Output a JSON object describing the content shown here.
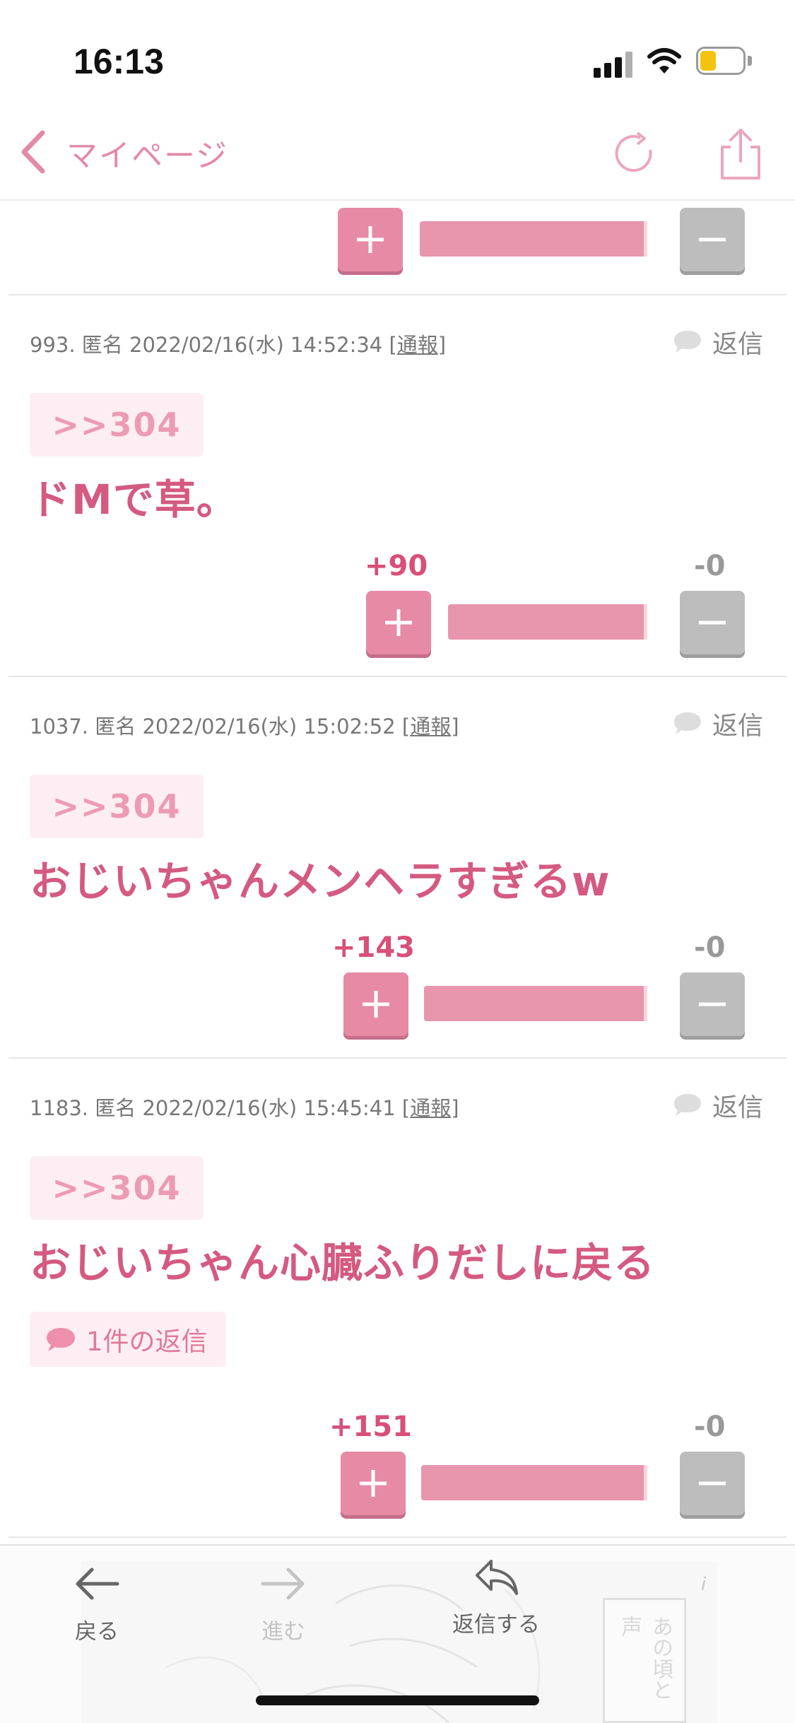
{
  "status_bar": {
    "time": "16:13"
  },
  "nav": {
    "title": "マイページ"
  },
  "colors": {
    "accent": "#e68aa6",
    "accent_dark": "#d45a80",
    "minus": "#bdbdbd"
  },
  "posts": [
    {
      "meta_prefix": "993. 匿名 2022/02/16(水) 14:52:34 [",
      "report": "通報",
      "meta_suffix": "]",
      "reply": "返信",
      "anchor": ">>304",
      "text": "ドMで草。",
      "plus": "+90",
      "minus": "-0",
      "plus_ratio": 1.0
    },
    {
      "meta_prefix": "1037. 匿名 2022/02/16(水) 15:02:52 [",
      "report": "通報",
      "meta_suffix": "]",
      "reply": "返信",
      "anchor": ">>304",
      "text": "おじいちゃんメンヘラすぎるw",
      "plus": "+143",
      "minus": "-0",
      "plus_ratio": 1.0
    },
    {
      "meta_prefix": "1183. 匿名 2022/02/16(水) 15:45:41 [",
      "report": "通報",
      "meta_suffix": "]",
      "reply": "返信",
      "anchor": ">>304",
      "text": "おじいちゃん心臓ふりだしに戻る",
      "reply_count": "1件の返信",
      "plus": "+151",
      "minus": "-0",
      "plus_ratio": 1.0
    }
  ],
  "toolbar": {
    "back": "戻る",
    "forward": "進む",
    "reply": "返信する",
    "ad_text": "あの頃と声",
    "ad_info": "i"
  }
}
